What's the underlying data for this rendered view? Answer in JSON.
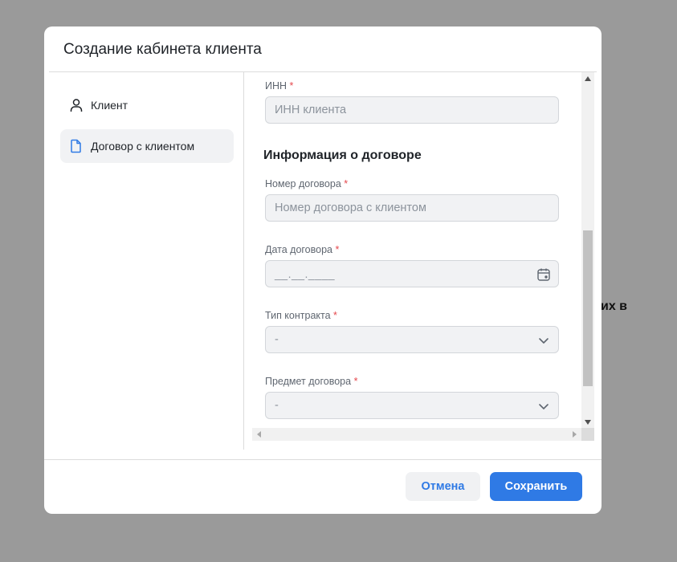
{
  "background": {
    "partial_text": "их в"
  },
  "modal": {
    "title": "Создание кабинета клиента",
    "sidebar": {
      "items": [
        {
          "label": "Клиент",
          "icon": "user-icon",
          "active": false
        },
        {
          "label": "Договор с клиентом",
          "icon": "document-icon",
          "active": true
        }
      ]
    },
    "form": {
      "inn": {
        "label": "ИНН",
        "required_mark": "*",
        "placeholder": "ИНН клиента"
      },
      "section_title": "Информация о договоре",
      "contract_number": {
        "label": "Номер договора",
        "required_mark": "*",
        "placeholder": "Номер договора с клиентом"
      },
      "contract_date": {
        "label": "Дата договора",
        "required_mark": "*",
        "mask": "__.__.____",
        "icon": "calendar-icon"
      },
      "contract_type": {
        "label": "Тип контракта",
        "required_mark": "*",
        "value": "-",
        "icon": "chevron-down-icon"
      },
      "contract_subject": {
        "label": "Предмет договора",
        "required_mark": "*",
        "value": "-",
        "icon": "chevron-down-icon"
      }
    },
    "footer": {
      "cancel_label": "Отмена",
      "save_label": "Сохранить"
    },
    "colors": {
      "accent": "#2f7ae5",
      "required": "#e5484d",
      "overlay": "#9a9a9a"
    }
  }
}
